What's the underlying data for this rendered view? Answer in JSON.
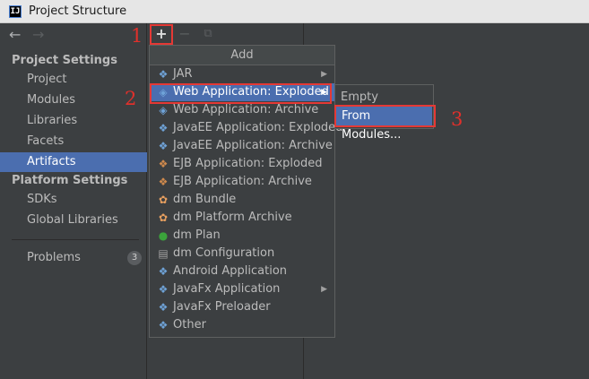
{
  "window": {
    "title": "Project Structure",
    "app_icon": "IJ"
  },
  "nav": {
    "back": "←",
    "forward": "→"
  },
  "sidebar": {
    "project_settings_label": "Project Settings",
    "project_items": [
      "Project",
      "Modules",
      "Libraries",
      "Facets",
      "Artifacts"
    ],
    "platform_settings_label": "Platform Settings",
    "platform_items": [
      "SDKs",
      "Global Libraries"
    ],
    "problems_label": "Problems",
    "problems_count": "3"
  },
  "toolbar": {
    "add": "+",
    "remove": "−",
    "copy": "⧉"
  },
  "annotations": [
    "1",
    "2",
    "3"
  ],
  "add_menu": {
    "header": "Add",
    "items": [
      {
        "label": "JAR",
        "icon": "diamond-icon",
        "submenu": true
      },
      {
        "label": "Web Application: Exploded",
        "icon": "web-icon",
        "submenu": true,
        "active": true
      },
      {
        "label": "Web Application: Archive",
        "icon": "web-icon"
      },
      {
        "label": "JavaEE Application: Exploded",
        "icon": "javaee-icon"
      },
      {
        "label": "JavaEE Application: Archive",
        "icon": "javaee-icon"
      },
      {
        "label": "EJB Application: Exploded",
        "icon": "ejb-icon"
      },
      {
        "label": "EJB Application: Archive",
        "icon": "ejb-icon"
      },
      {
        "label": "dm Bundle",
        "icon": "bundle-icon"
      },
      {
        "label": "dm Platform Archive",
        "icon": "bundle-icon"
      },
      {
        "label": "dm Plan",
        "icon": "plan-icon"
      },
      {
        "label": "dm Configuration",
        "icon": "config-icon"
      },
      {
        "label": "Android Application",
        "icon": "diamond-icon"
      },
      {
        "label": "JavaFx Application",
        "icon": "diamond-icon",
        "submenu": true
      },
      {
        "label": "JavaFx Preloader",
        "icon": "diamond-icon"
      },
      {
        "label": "Other",
        "icon": "diamond-icon"
      }
    ]
  },
  "submenu": {
    "items": [
      "Empty",
      "From Modules..."
    ]
  },
  "colors": {
    "selection": "#4b6eaf",
    "annotation_red": "#e53935",
    "background": "#3c3f41"
  }
}
